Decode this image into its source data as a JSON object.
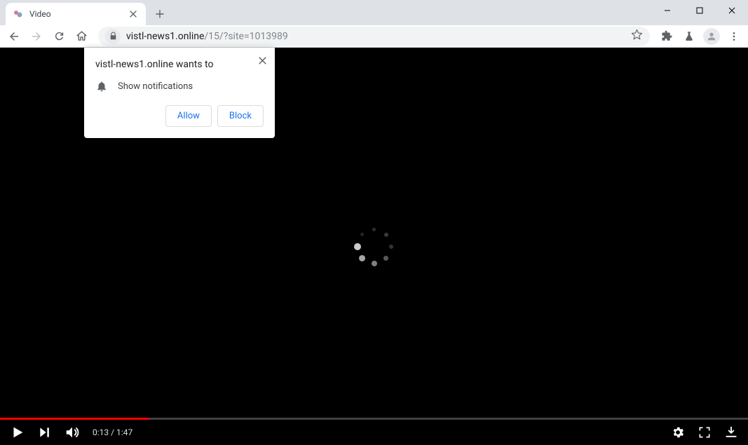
{
  "tab": {
    "title": "Video"
  },
  "url": {
    "host": "vistl-news1.online",
    "path": "/15/?site=1013989"
  },
  "popup": {
    "title": "vistl-news1.online wants to",
    "permission": "Show notifications",
    "allow": "Allow",
    "block": "Block"
  },
  "video": {
    "time": "0:13 / 1:47",
    "progress_percent": 20
  }
}
